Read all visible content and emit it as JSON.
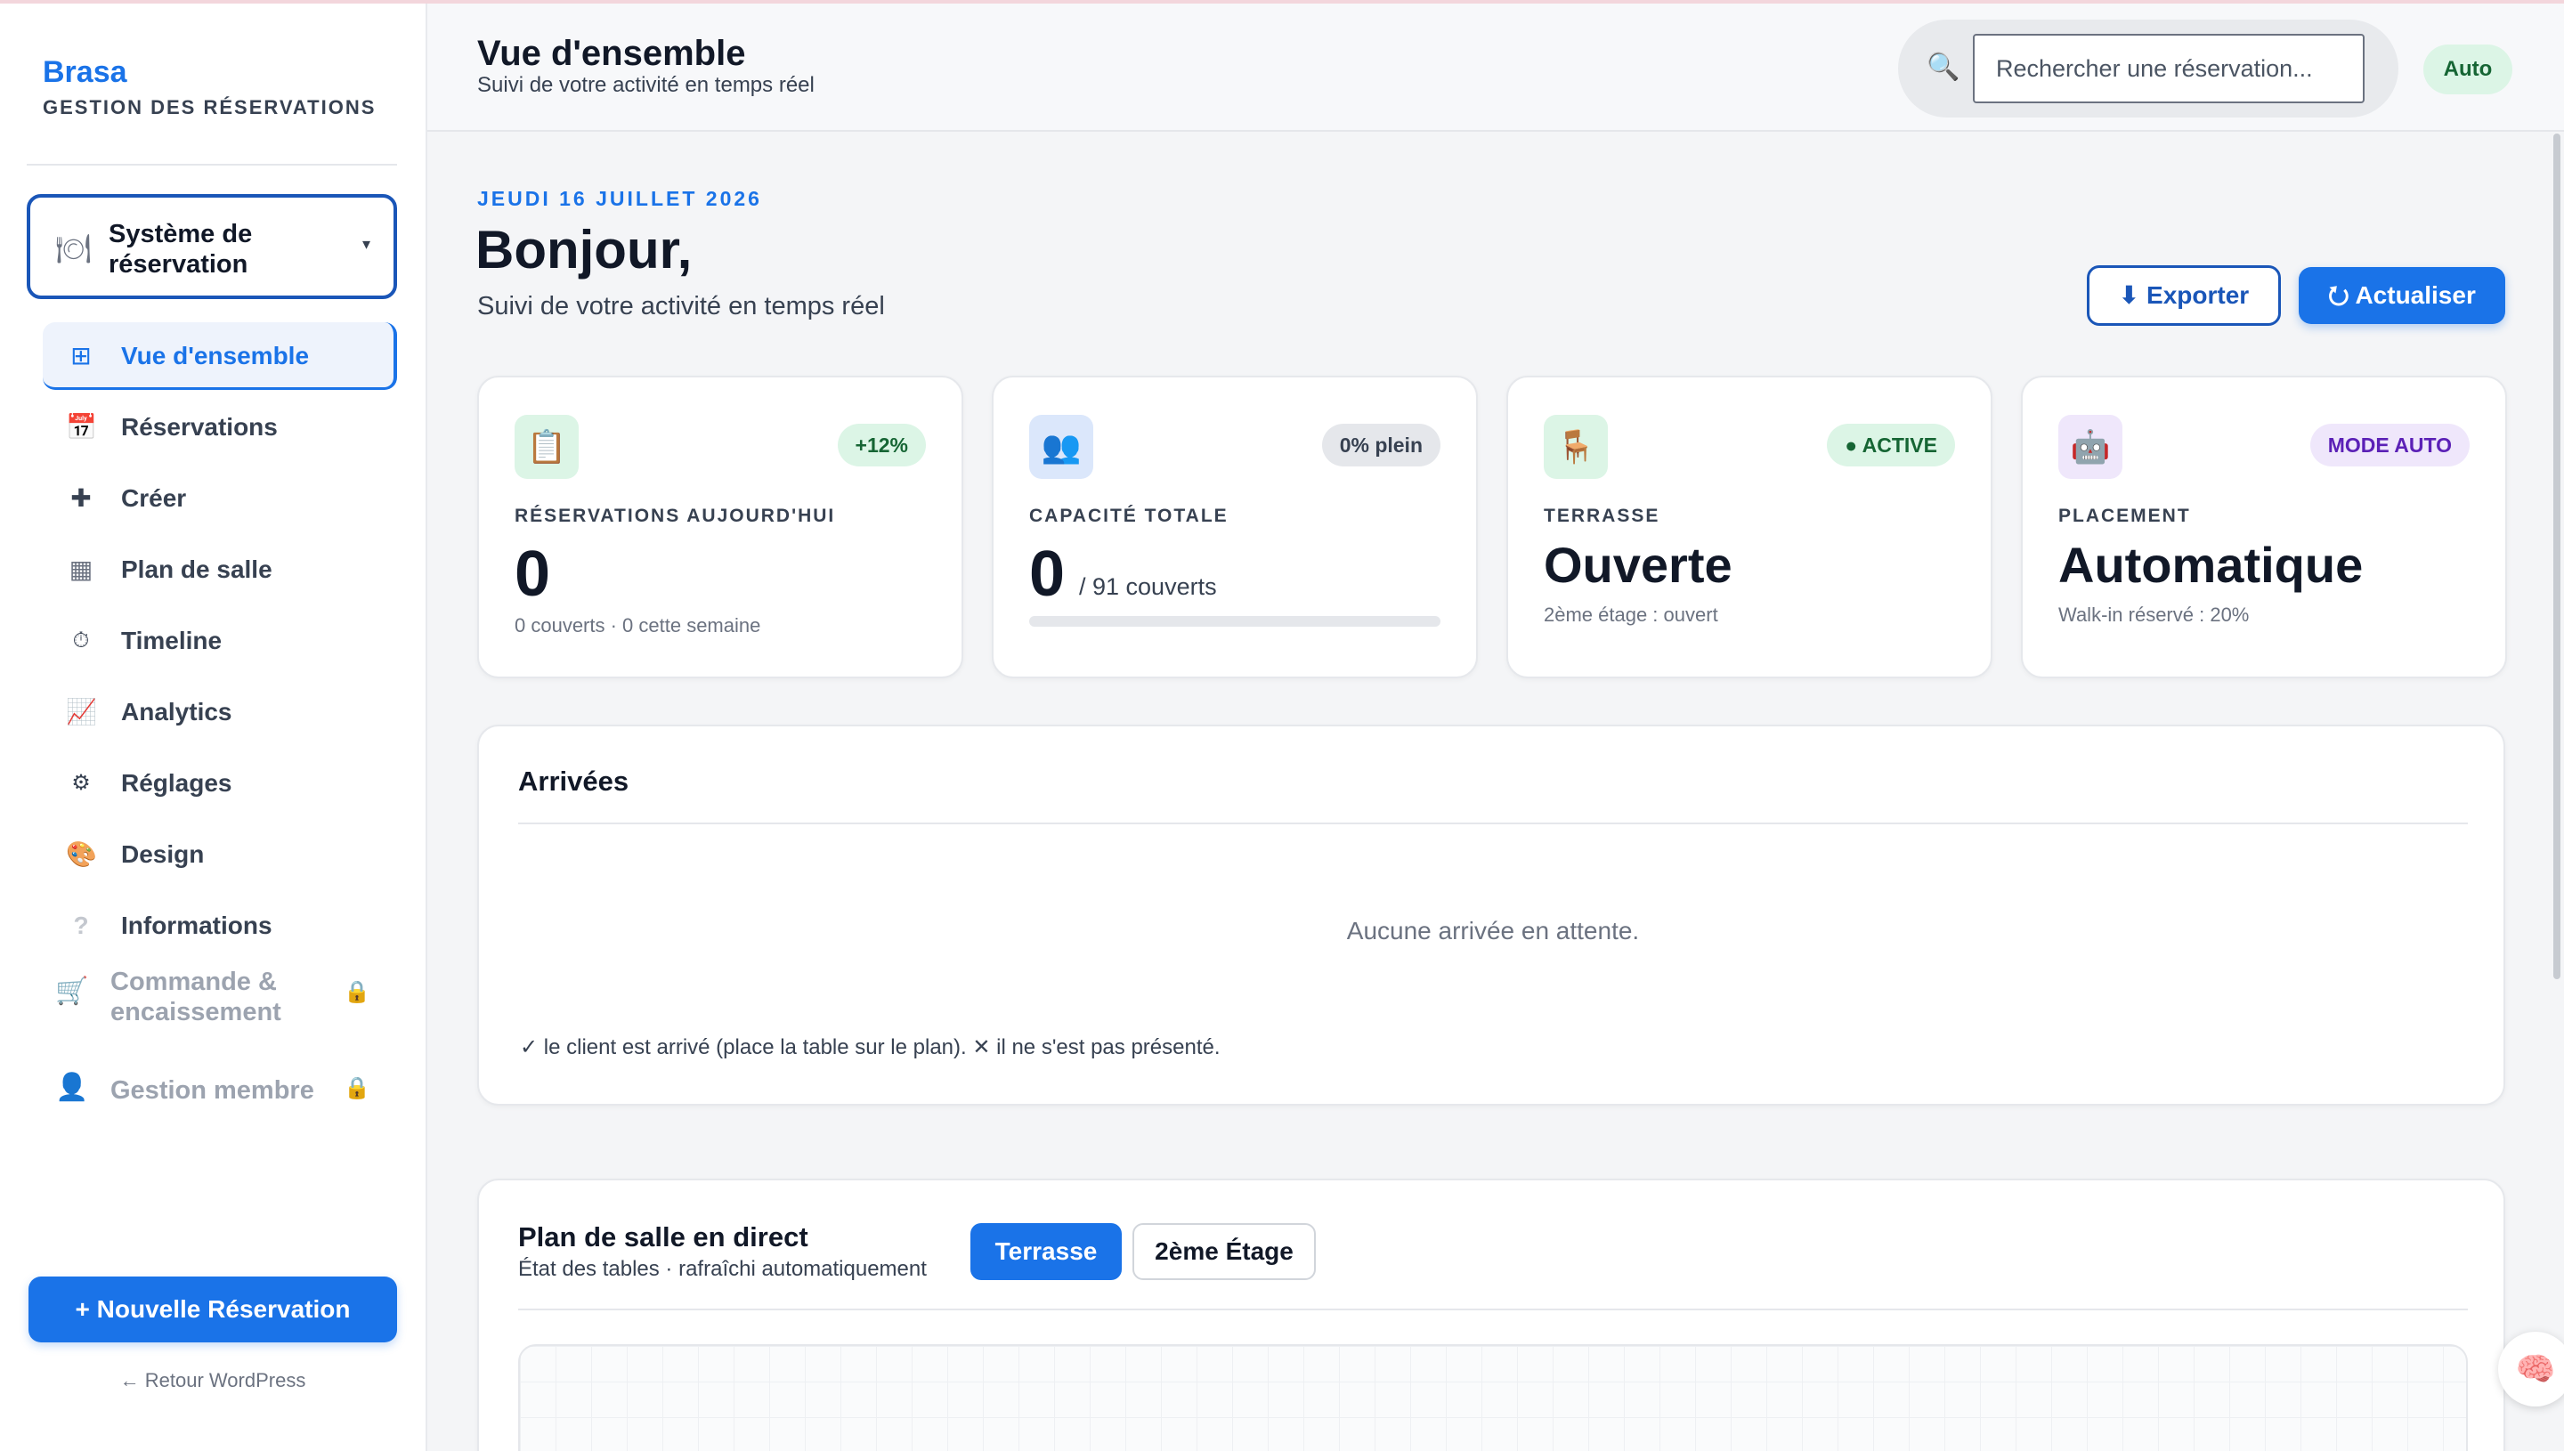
{
  "sidebar": {
    "brand": "Brasa",
    "brand_sub": "GESTION DES RÉSERVATIONS",
    "system_label": "Système de réservation",
    "system_icon": "plate-icon",
    "items": [
      {
        "label": "Vue d'ensemble",
        "icon": "grid-icon",
        "glyph": "⊞",
        "active": true
      },
      {
        "label": "Réservations",
        "icon": "calendar-icon",
        "glyph": "📅",
        "active": false
      },
      {
        "label": "Créer",
        "icon": "plus-icon",
        "glyph": "✚",
        "active": false
      },
      {
        "label": "Plan de salle",
        "icon": "floor-plan-icon",
        "glyph": "▦",
        "active": false
      },
      {
        "label": "Timeline",
        "icon": "clock-icon",
        "glyph": "⏱",
        "active": false
      },
      {
        "label": "Analytics",
        "icon": "chart-icon",
        "glyph": "📈",
        "active": false
      },
      {
        "label": "Réglages",
        "icon": "gear-icon",
        "glyph": "⚙",
        "active": false
      },
      {
        "label": "Design",
        "icon": "palette-icon",
        "glyph": "🎨",
        "active": false
      },
      {
        "label": "Informations",
        "icon": "question-icon",
        "glyph": "?",
        "active": false
      }
    ],
    "locked": [
      {
        "label": "Commande & encaissement",
        "icon": "cart-icon"
      },
      {
        "label": "Gestion membre",
        "icon": "user-icon"
      }
    ],
    "new_button": "+ Nouvelle Réservation",
    "back_link": "← Retour WordPress"
  },
  "header": {
    "title": "Vue d'ensemble",
    "subtitle": "Suivi de votre activité en temps réel",
    "search_placeholder": "Rechercher une réservation...",
    "auto_label": "Auto"
  },
  "main": {
    "date": "JEUDI 16 JUILLET 2026",
    "greeting": "Bonjour,",
    "greeting_sub": "Suivi de votre activité en temps réel",
    "export_label": "⬇ Exporter",
    "refresh_label": "⭮ Actualiser"
  },
  "stats": [
    {
      "title": "RÉSERVATIONS AUJOURD'HUI",
      "value": "0",
      "badge": "+12%",
      "sub": "0 couverts · 0 cette semaine",
      "icon": "clipboard-icon"
    },
    {
      "title": "CAPACITÉ TOTALE",
      "value": "0",
      "unit": "/ 91 couverts",
      "badge": "0% plein",
      "fill_percent": 0,
      "icon": "people-icon"
    },
    {
      "title": "TERRASSE",
      "value": "Ouverte",
      "badge": "● ACTIVE",
      "sub": "2ème étage : ouvert",
      "icon": "chair-icon"
    },
    {
      "title": "PLACEMENT",
      "value": "Automatique",
      "badge": "MODE AUTO",
      "sub": "Walk-in réservé : 20%",
      "icon": "robot-icon"
    }
  ],
  "arrivals": {
    "title": "Arrivées",
    "empty": "Aucune arrivée en attente.",
    "legend_check": "✓ le client est arrivé (place la table sur le plan).",
    "legend_cross": "✕ il ne s'est pas présenté."
  },
  "floor_plan": {
    "title": "Plan de salle en direct",
    "subtitle": "État des tables · rafraîchi automatiquement",
    "tabs": [
      "Terrasse",
      "2ème Étage"
    ],
    "active_tab": "Terrasse"
  },
  "colors": {
    "accent": "#1a73e8",
    "accent_dark": "#1a56b8",
    "success_bg": "#dcf5e6",
    "purple_bg": "#efe7fb"
  }
}
